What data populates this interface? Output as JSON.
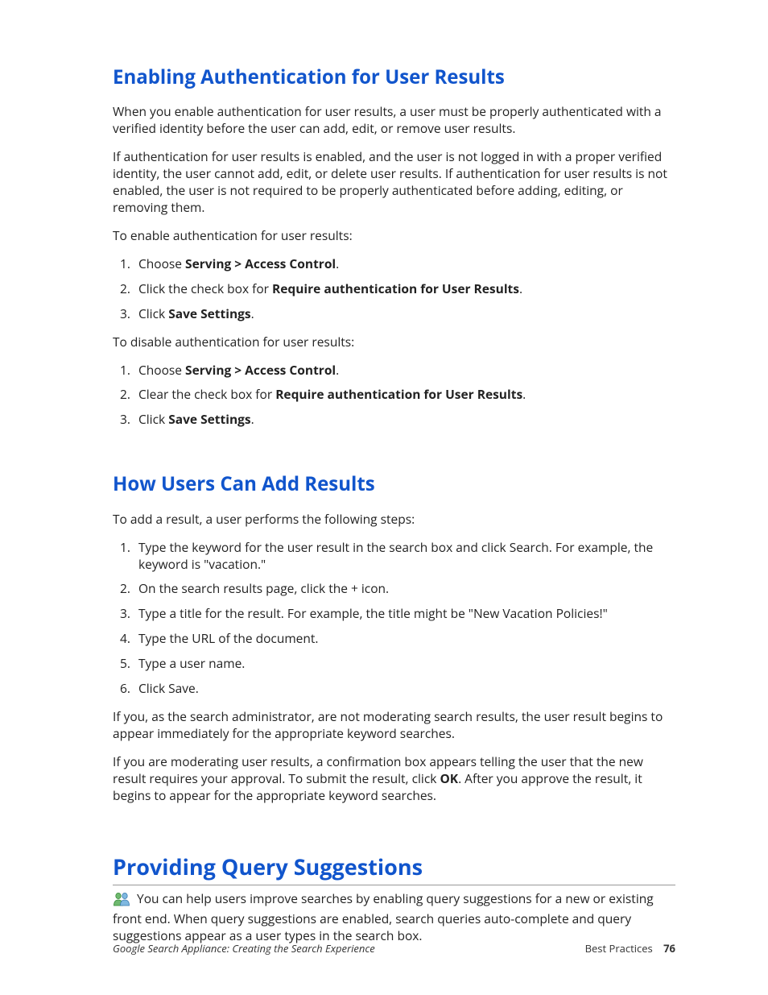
{
  "section1": {
    "title": "Enabling Authentication for User Results",
    "p1": "When you enable authentication for user results, a user must be properly authenticated with a verified identity before the user can add, edit, or remove user results.",
    "p2": "If authentication for user results is enabled, and the user is not logged in with a proper verified identity, the user cannot add, edit, or delete user results. If authentication for user results is not enabled, the user is not required to be properly authenticated before adding, editing, or removing them.",
    "p3": "To enable authentication for user results:",
    "listA": {
      "i1_pre": "Choose ",
      "i1_bold": "Serving > Access Control",
      "i1_post": ".",
      "i2_pre": "Click the check box for ",
      "i2_bold": "Require authentication for User Results",
      "i2_post": ".",
      "i3_pre": "Click ",
      "i3_bold": "Save Settings",
      "i3_post": "."
    },
    "p4": "To disable authentication for user results:",
    "listB": {
      "i1_pre": "Choose ",
      "i1_bold": "Serving > Access Control",
      "i1_post": ".",
      "i2_pre": "Clear the check box for ",
      "i2_bold": "Require authentication for User Results",
      "i2_post": ".",
      "i3_pre": "Click ",
      "i3_bold": "Save Settings",
      "i3_post": "."
    }
  },
  "section2": {
    "title": "How Users Can Add Results",
    "p1": "To add a result, a user performs the following steps:",
    "list": {
      "i1": "Type the keyword for the user result in the search box and click Search. For example, the keyword is \"vacation.\"",
      "i2": "On the search results page, click the + icon.",
      "i3": "Type a title for the result. For example, the title might be \"New Vacation Policies!\"",
      "i4": "Type the URL of the document.",
      "i5": "Type a user name.",
      "i6": "Click Save."
    },
    "p2": "If you, as the search administrator, are not moderating search results, the user result begins to appear immediately for the appropriate keyword searches.",
    "p3a": "If you are moderating user results, a confirmation box appears telling the user that the new result requires your approval. To submit the result, click ",
    "p3b": "OK",
    "p3c": ". After you approve the result, it begins to appear for the appropriate keyword searches."
  },
  "section3": {
    "title": "Providing Query Suggestions",
    "p1": " You can help users improve searches by enabling query suggestions for a new or existing front end. When query suggestions are enabled, search queries auto-complete and query suggestions appear as a user types in the search box."
  },
  "footer": {
    "left": "Google Search Appliance: Creating the Search Experience",
    "right_label": "Best Practices",
    "page": "76"
  }
}
